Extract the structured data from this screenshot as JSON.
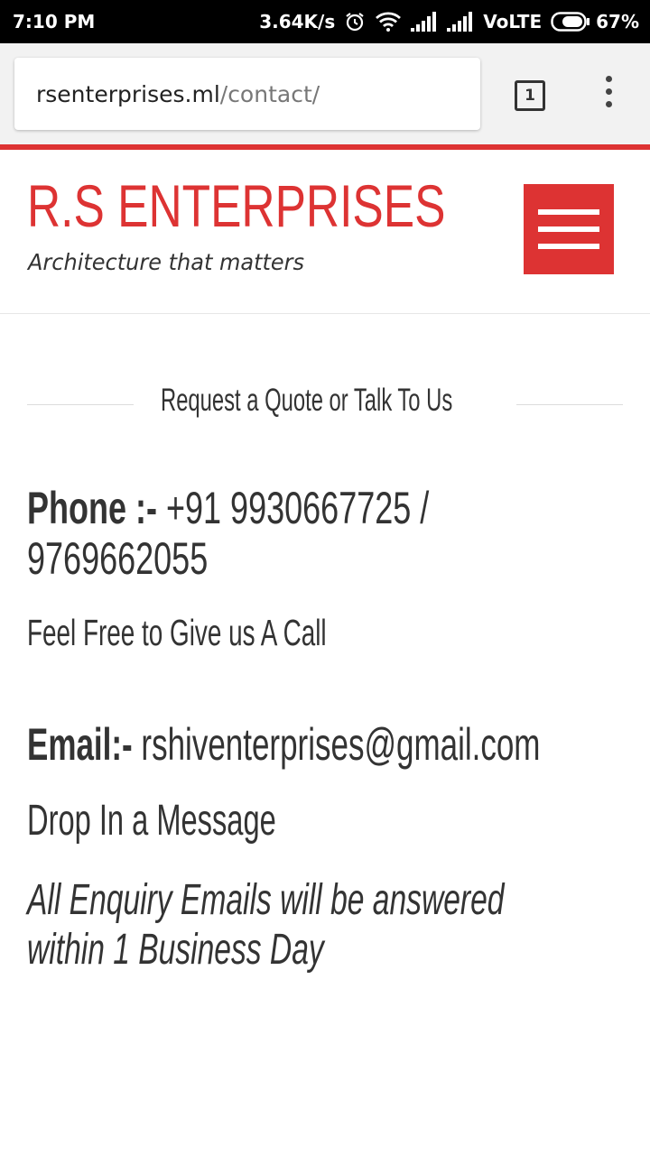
{
  "status_bar": {
    "time": "7:10 PM",
    "speed": "3.64K/s",
    "network": "VoLTE",
    "battery": "67%"
  },
  "browser": {
    "url_host": "rsenterprises.ml",
    "url_path": "/contact/",
    "tab_count": "1"
  },
  "header": {
    "title": "R.S ENTERPRISES",
    "tagline": "Architecture that matters"
  },
  "content": {
    "section_heading": "Request a Quote or Talk To Us",
    "phone_label": "Phone :-",
    "phone_value_line1": " +91  9930667725 /",
    "phone_value_line2": "9769662055",
    "call_text": "Feel Free to Give us A Call",
    "email_label": "Email:-",
    "email_value": " rshiventerprises@gmail.com",
    "drop_text": "Drop In a Message",
    "enquiry_line1": "All Enquiry Emails will be answered",
    "enquiry_line2": "within 1 Business Day"
  },
  "colors": {
    "accent": "#dd3333",
    "text": "#333333"
  }
}
